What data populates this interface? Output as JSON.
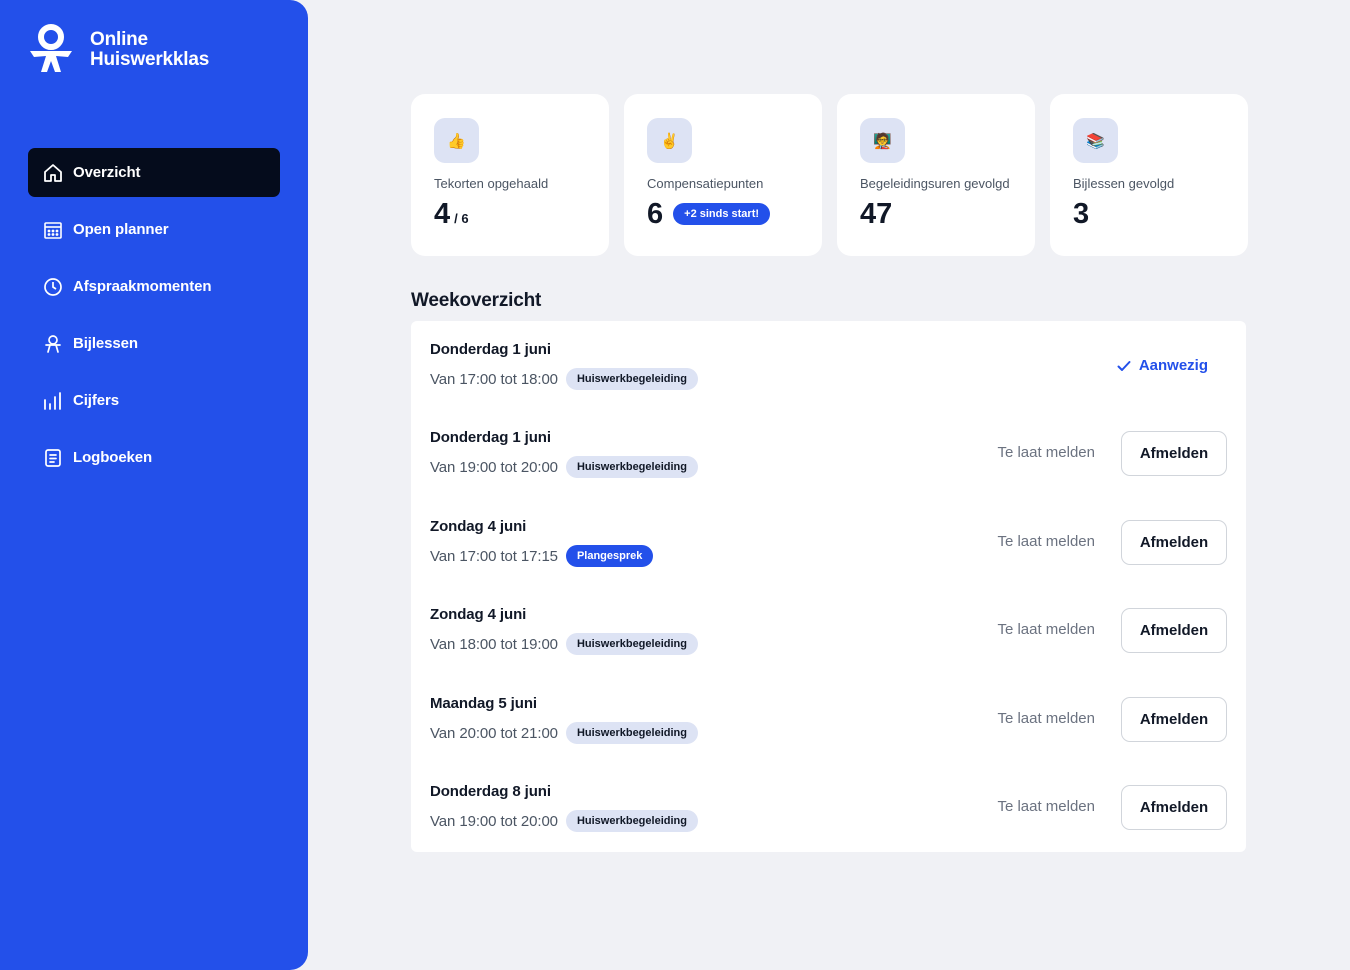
{
  "app": {
    "name_line1": "Online",
    "name_line2": "Huiswerkklas"
  },
  "colors": {
    "brand": "#2350ea",
    "active_nav": "#050c1c",
    "background": "#f0f1f5"
  },
  "nav": [
    {
      "label": "Overzicht",
      "icon": "home-icon",
      "active": true
    },
    {
      "label": "Open planner",
      "icon": "calendar-icon",
      "active": false
    },
    {
      "label": "Afspraakmomenten",
      "icon": "clock-icon",
      "active": false
    },
    {
      "label": "Bijlessen",
      "icon": "person-icon",
      "active": false
    },
    {
      "label": "Cijfers",
      "icon": "bar-chart-icon",
      "active": false
    },
    {
      "label": "Logboeken",
      "icon": "document-icon",
      "active": false
    }
  ],
  "stats": [
    {
      "label": "Tekorten opgehaald",
      "value": "4",
      "sub": "/ 6",
      "icon": "👍",
      "icon_name": "thumbs-up-icon"
    },
    {
      "label": "Compensatiepunten",
      "value": "6",
      "badge": "+2 sinds start!",
      "icon": "✌️",
      "icon_name": "victory-hand-icon"
    },
    {
      "label": "Begeleidingsuren gevolgd",
      "value": "47",
      "icon": "🧑‍🏫",
      "icon_name": "teacher-icon"
    },
    {
      "label": "Bijlessen gevolgd",
      "value": "3",
      "icon": "📚",
      "icon_name": "books-icon"
    }
  ],
  "week": {
    "title": "Weekoverzicht",
    "late_label": "Te laat melden",
    "cancel_label": "Afmelden",
    "present_label": "Aanwezig",
    "rows": [
      {
        "day": "Donderdag 1 juni",
        "time": "Van 17:00 tot 18:00",
        "tag": "Huiswerkbegeleiding",
        "status": "present"
      },
      {
        "day": "Donderdag 1 juni",
        "time": "Van 19:00 tot 20:00",
        "tag": "Huiswerkbegeleiding",
        "status": "actions"
      },
      {
        "day": "Zondag 4 juni",
        "time": "Van 17:00 tot 17:15",
        "tag": "Plangesprek",
        "tag_style": "blue",
        "status": "actions"
      },
      {
        "day": "Zondag 4 juni",
        "time": "Van 18:00 tot 19:00",
        "tag": "Huiswerkbegeleiding",
        "status": "actions"
      },
      {
        "day": "Maandag 5 juni",
        "time": "Van 20:00 tot 21:00",
        "tag": "Huiswerkbegeleiding",
        "status": "actions"
      },
      {
        "day": "Donderdag 8 juni",
        "time": "Van 19:00 tot 20:00",
        "tag": "Huiswerkbegeleiding",
        "status": "actions"
      }
    ]
  }
}
